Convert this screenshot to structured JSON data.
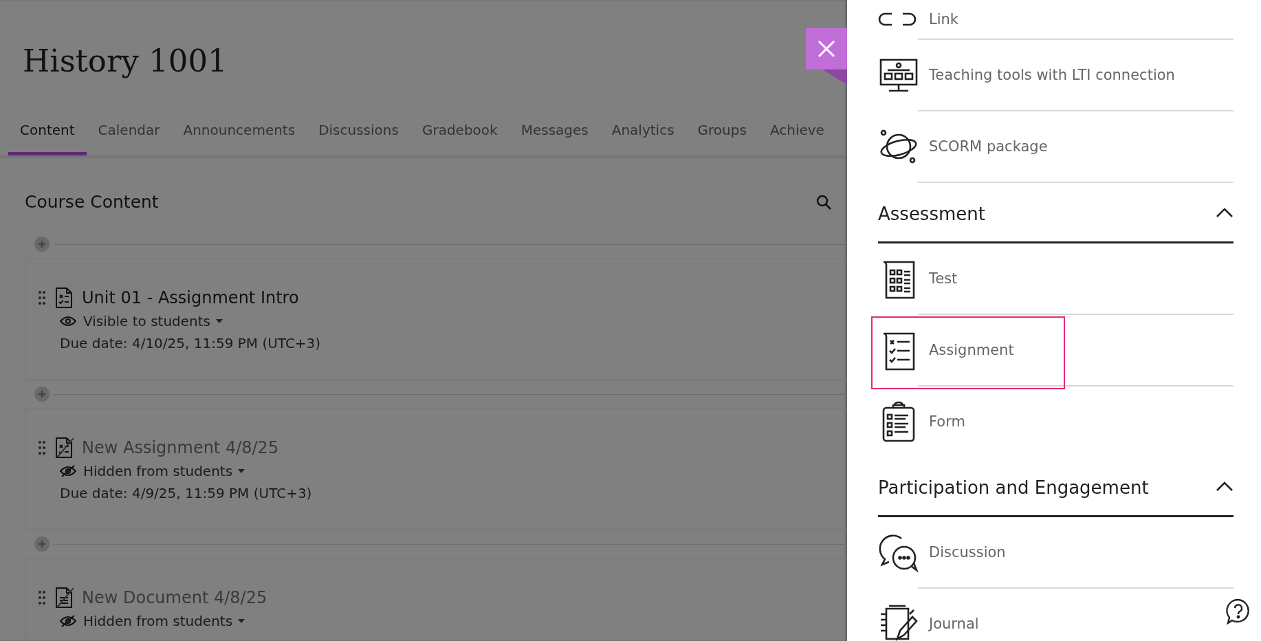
{
  "course": {
    "title": "History 1001"
  },
  "tabs": [
    {
      "label": "Content",
      "selected": true
    },
    {
      "label": "Calendar",
      "selected": false
    },
    {
      "label": "Announcements",
      "selected": false
    },
    {
      "label": "Discussions",
      "selected": false
    },
    {
      "label": "Gradebook",
      "selected": false
    },
    {
      "label": "Messages",
      "selected": false
    },
    {
      "label": "Analytics",
      "selected": false
    },
    {
      "label": "Groups",
      "selected": false
    },
    {
      "label": "Achieve",
      "selected": false
    }
  ],
  "content": {
    "heading": "Course Content",
    "items": [
      {
        "title": "Unit 01 - Assignment Intro",
        "kind": "assignment",
        "visible": true,
        "visibility": "Visible to students",
        "due": "Due date: 4/10/25, 11:59 PM (UTC+3)"
      },
      {
        "title": "New Assignment 4/8/25",
        "kind": "assignment",
        "visible": false,
        "visibility": "Hidden from students",
        "due": "Due date: 4/9/25, 11:59 PM (UTC+3)"
      },
      {
        "title": "New Document 4/8/25",
        "kind": "document",
        "visible": false,
        "visibility": "Hidden from students"
      }
    ]
  },
  "panel": {
    "sections": [
      {
        "items": [
          {
            "label": "Link",
            "kind": "link",
            "highlighted": false
          },
          {
            "label": "Teaching tools with LTI connection",
            "kind": "lti",
            "highlighted": false
          },
          {
            "label": "SCORM package",
            "kind": "scorm",
            "highlighted": false
          }
        ]
      },
      {
        "title": "Assessment",
        "expanded": true,
        "items": [
          {
            "label": "Test",
            "kind": "test",
            "highlighted": false
          },
          {
            "label": "Assignment",
            "kind": "assignment",
            "highlighted": true
          },
          {
            "label": "Form",
            "kind": "form",
            "highlighted": false
          }
        ]
      },
      {
        "title": "Participation and Engagement",
        "expanded": true,
        "items": [
          {
            "label": "Discussion",
            "kind": "discussion",
            "highlighted": false
          },
          {
            "label": "Journal",
            "kind": "journal",
            "highlighted": false
          }
        ]
      }
    ]
  }
}
